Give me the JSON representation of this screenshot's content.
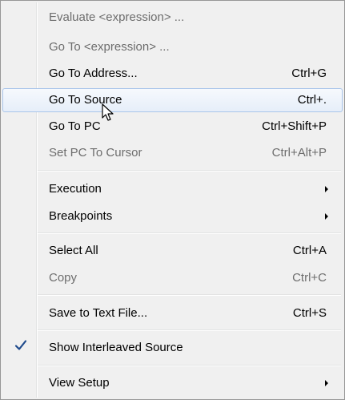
{
  "menu": {
    "items": [
      {
        "label": "Evaluate <expression> ...",
        "shortcut": "",
        "disabled": true
      },
      {
        "label": "Go To <expression> ...",
        "shortcut": "",
        "disabled": true
      },
      {
        "label": "Go To Address...",
        "shortcut": "Ctrl+G",
        "disabled": false
      },
      {
        "label": "Go To Source",
        "shortcut": "Ctrl+.",
        "disabled": false,
        "highlighted": true
      },
      {
        "label": "Go To PC",
        "shortcut": "Ctrl+Shift+P",
        "disabled": false
      },
      {
        "label": "Set PC To Cursor",
        "shortcut": "Ctrl+Alt+P",
        "disabled": true
      },
      {
        "label": "Execution",
        "submenu": true
      },
      {
        "label": "Breakpoints",
        "submenu": true
      },
      {
        "label": "Select All",
        "shortcut": "Ctrl+A",
        "disabled": false
      },
      {
        "label": "Copy",
        "shortcut": "Ctrl+C",
        "disabled": true
      },
      {
        "label": "Save to Text File...",
        "shortcut": "Ctrl+S",
        "disabled": false
      },
      {
        "label": "Show Interleaved Source",
        "checked": true
      },
      {
        "label": "View Setup",
        "submenu": true
      }
    ]
  },
  "icons": {
    "check": "checkmark-icon",
    "submenu": "submenu-arrow-icon",
    "cursor": "mouse-pointer-icon"
  },
  "colors": {
    "highlight_border": "#a9c5ea",
    "disabled_text": "#6d6d6d",
    "check": "#1e4a8c"
  }
}
